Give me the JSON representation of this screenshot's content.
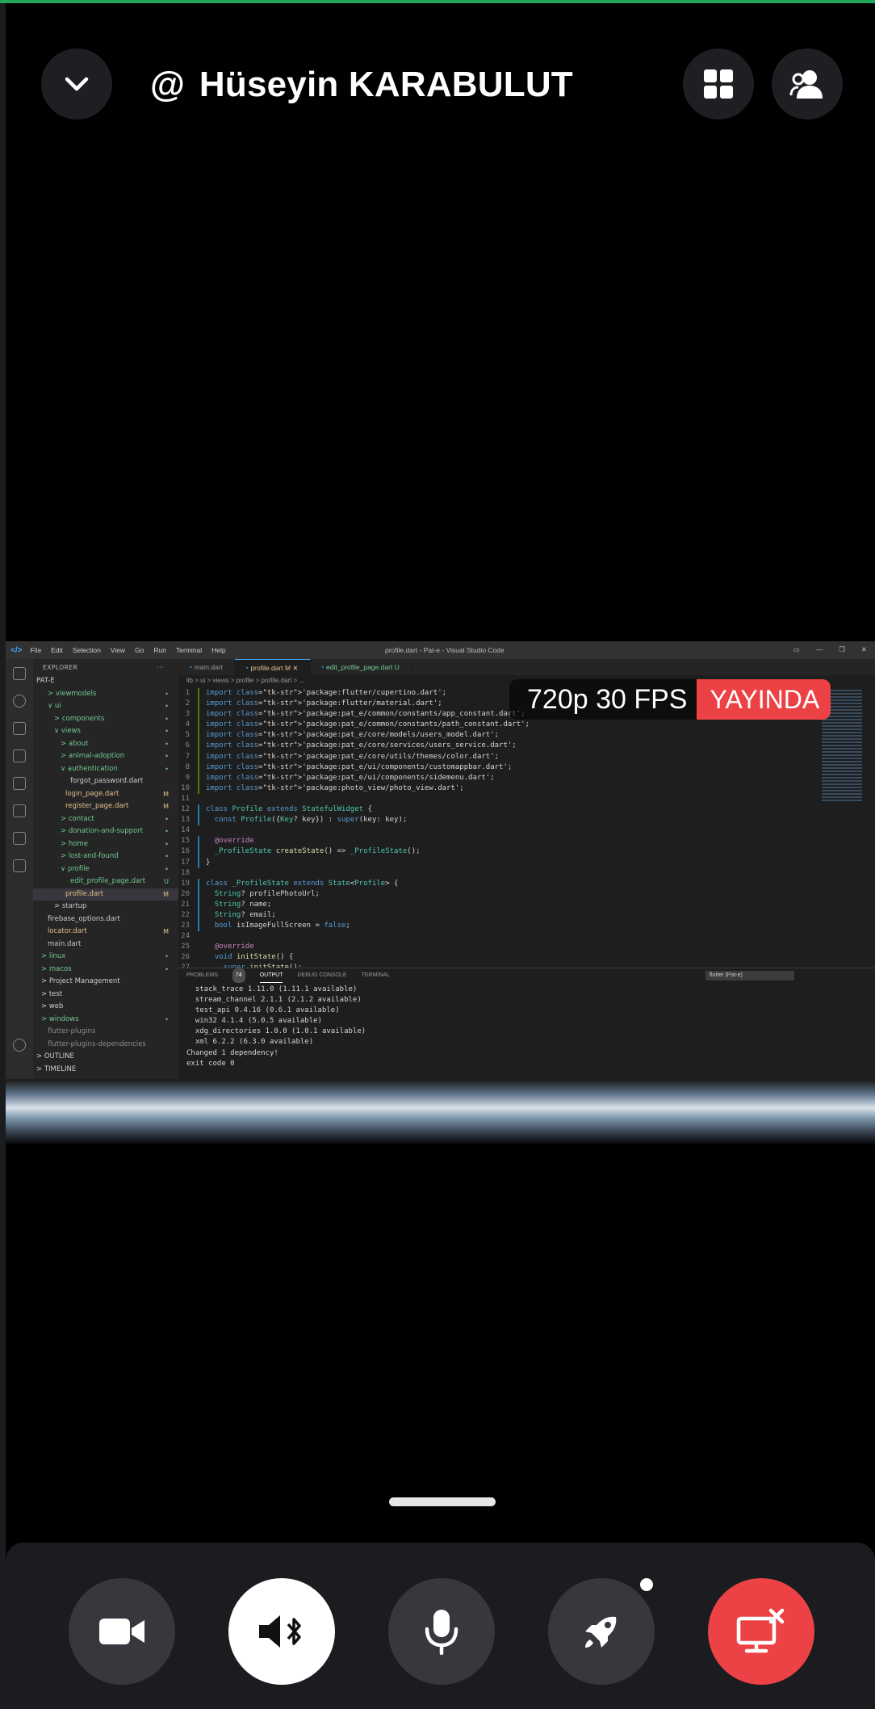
{
  "header": {
    "title": "Hüseyin KARABULUT",
    "at_symbol": "@",
    "icons": {
      "collapse": "chevron-down-icon",
      "grid": "grid-icon",
      "people": "people-icon"
    }
  },
  "stream": {
    "quality_label": "720p 30 FPS",
    "live_label": "YAYINDA",
    "colors": {
      "live": "#ed4245",
      "accent_top": "#23a55a"
    }
  },
  "vscode": {
    "menu": [
      "File",
      "Edit",
      "Selection",
      "View",
      "Go",
      "Run",
      "Terminal",
      "Help"
    ],
    "window_title": "profile.dart - Pat-e - Visual Studio Code",
    "explorer_header": "EXPLORER",
    "explorer_more": "···",
    "tree": [
      {
        "label": "PAT-E",
        "badge": ""
      },
      {
        "label": "> viewmodels",
        "badge": "•"
      },
      {
        "label": "∨ ui",
        "badge": "•"
      },
      {
        "label": "> components",
        "badge": "•"
      },
      {
        "label": "∨ views",
        "badge": "•"
      },
      {
        "label": "> about",
        "badge": "•"
      },
      {
        "label": "> animal-adoption",
        "badge": "•"
      },
      {
        "label": "∨ authentication",
        "badge": "•"
      },
      {
        "label": "forgot_password.dart",
        "badge": ""
      },
      {
        "label": "login_page.dart",
        "badge": "M"
      },
      {
        "label": "register_page.dart",
        "badge": "M"
      },
      {
        "label": "> contact",
        "badge": "•"
      },
      {
        "label": "> donation-and-support",
        "badge": "•"
      },
      {
        "label": "> home",
        "badge": "•"
      },
      {
        "label": "> lost-and-found",
        "badge": "•"
      },
      {
        "label": "∨ profile",
        "badge": "•"
      },
      {
        "label": "edit_profile_page.dart",
        "badge": "U"
      },
      {
        "label": "profile.dart",
        "badge": "M"
      },
      {
        "label": "> startup",
        "badge": ""
      },
      {
        "label": "firebase_options.dart",
        "badge": ""
      },
      {
        "label": "locator.dart",
        "badge": "M"
      },
      {
        "label": "main.dart",
        "badge": ""
      },
      {
        "label": "> linux",
        "badge": "•"
      },
      {
        "label": "> macos",
        "badge": "•"
      },
      {
        "label": "> Project Management",
        "badge": ""
      },
      {
        "label": "> test",
        "badge": ""
      },
      {
        "label": "> web",
        "badge": ""
      },
      {
        "label": "> windows",
        "badge": "•"
      },
      {
        "label": "flutter-plugins",
        "badge": ""
      },
      {
        "label": "flutter-plugins-dependencies",
        "badge": ""
      },
      {
        "label": "> OUTLINE",
        "badge": ""
      },
      {
        "label": "> TIMELINE",
        "badge": ""
      }
    ],
    "tabs": [
      {
        "label": "main.dart"
      },
      {
        "label": "profile.dart M ✕"
      },
      {
        "label": "edit_profile_page.dart U"
      }
    ],
    "breadcrumb": "lib > ui > views > profile > profile.dart > ...",
    "code_lines": [
      "import 'package:flutter/cupertino.dart';",
      "import 'package:flutter/material.dart';",
      "import 'package:pat_e/common/constants/app_constant.dart';",
      "import 'package:pat_e/common/constants/path_constant.dart';",
      "import 'package:pat_e/core/models/users_model.dart';",
      "import 'package:pat_e/core/services/users_service.dart';",
      "import 'package:pat_e/core/utils/themes/color.dart';",
      "import 'package:pat_e/ui/components/customappbar.dart';",
      "import 'package:pat_e/ui/components/sidemenu.dart';",
      "import 'package:photo_view/photo_view.dart';",
      "",
      "class Profile extends StatefulWidget {",
      "  const Profile({Key? key}) : super(key: key);",
      "",
      "  @override",
      "  _ProfileState createState() => _ProfileState();",
      "}",
      "",
      "class _ProfileState extends State<Profile> {",
      "  String? profilePhotoUrl;",
      "  String? name;",
      "  String? email;",
      "  bool isImageFullScreen = false;",
      "",
      "  @override",
      "  void initState() {",
      "    super.initState();"
    ],
    "panel_tabs": [
      "PROBLEMS",
      "74",
      "OUTPUT",
      "DEBUG CONSOLE",
      "TERMINAL"
    ],
    "panel_select": "flutter (Pat-e)",
    "output_lines": [
      "  stack_trace 1.11.0 (1.11.1 available)",
      "  stream_channel 2.1.1 (2.1.2 available)",
      "  test_api 0.4.16 (0.6.1 available)",
      "  win32 4.1.4 (5.0.5 available)",
      "  xdg_directories 1.0.0 (1.0.1 available)",
      "  xml 6.2.2 (6.3.0 available)",
      "Changed 1 dependency!",
      "exit code 0"
    ]
  },
  "controls": {
    "buttons": [
      {
        "name": "camera-button",
        "icon": "video-camera-icon"
      },
      {
        "name": "audio-output-button",
        "icon": "speaker-bluetooth-icon"
      },
      {
        "name": "microphone-button",
        "icon": "microphone-icon"
      },
      {
        "name": "activities-button",
        "icon": "rocket-icon"
      },
      {
        "name": "leave-call-button",
        "icon": "disconnect-icon"
      }
    ]
  }
}
